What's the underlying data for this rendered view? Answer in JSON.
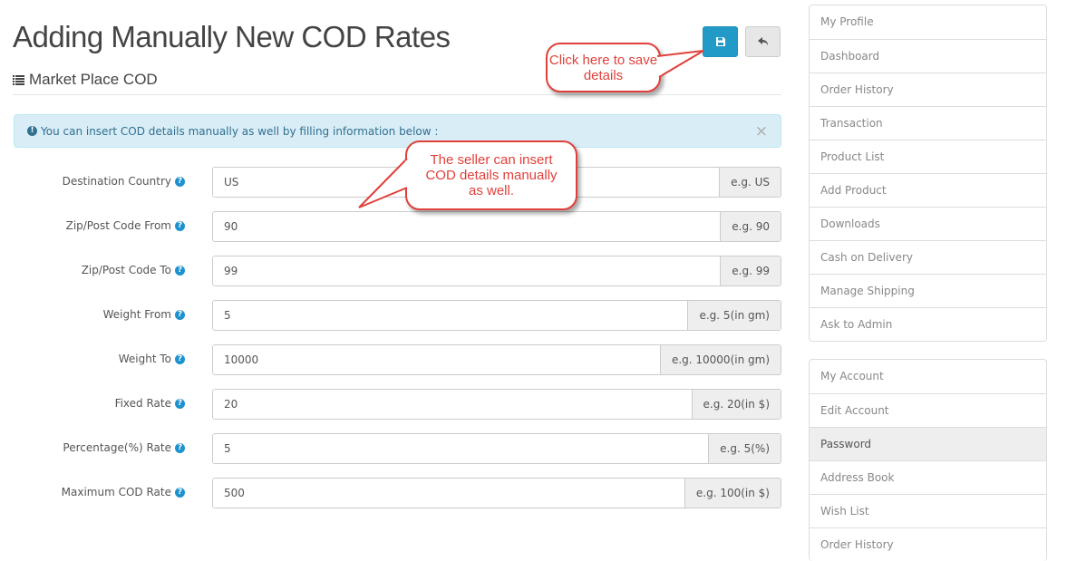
{
  "page": {
    "title": "Adding Manually New COD Rates",
    "subtitle": "Market Place COD"
  },
  "alert": {
    "text": "You can insert COD details manually as well by filling information below :",
    "close": "×"
  },
  "form": [
    {
      "label": "Destination Country",
      "value": "US",
      "hint": "e.g. US"
    },
    {
      "label": "Zip/Post Code From",
      "value": "90",
      "hint": "e.g. 90"
    },
    {
      "label": "Zip/Post Code To",
      "value": "99",
      "hint": "e.g. 99"
    },
    {
      "label": "Weight From",
      "value": "5",
      "hint": "e.g. 5(in gm)"
    },
    {
      "label": "Weight To",
      "value": "10000",
      "hint": "e.g. 10000(in gm)"
    },
    {
      "label": "Fixed Rate",
      "value": "20",
      "hint": "e.g. 20(in $)"
    },
    {
      "label": "Percentage(%) Rate",
      "value": "5",
      "hint": "e.g. 5(%)"
    },
    {
      "label": "Maximum COD Rate",
      "value": "500",
      "hint": "e.g. 100(in $)"
    }
  ],
  "help_glyph": "?",
  "callouts": {
    "save": "Click here to save details",
    "insert": "The seller can insert COD details manually as well."
  },
  "sidebar1": [
    "My Profile",
    "Dashboard",
    "Order History",
    "Transaction",
    "Product List",
    "Add Product",
    "Downloads",
    "Cash on Delivery",
    "Manage Shipping",
    "Ask to Admin"
  ],
  "sidebar2": [
    "My Account",
    "Edit Account",
    "Password",
    "Address Book",
    "Wish List",
    "Order History"
  ],
  "colors": {
    "primary": "#229ac8",
    "callout": "#e0403a"
  }
}
